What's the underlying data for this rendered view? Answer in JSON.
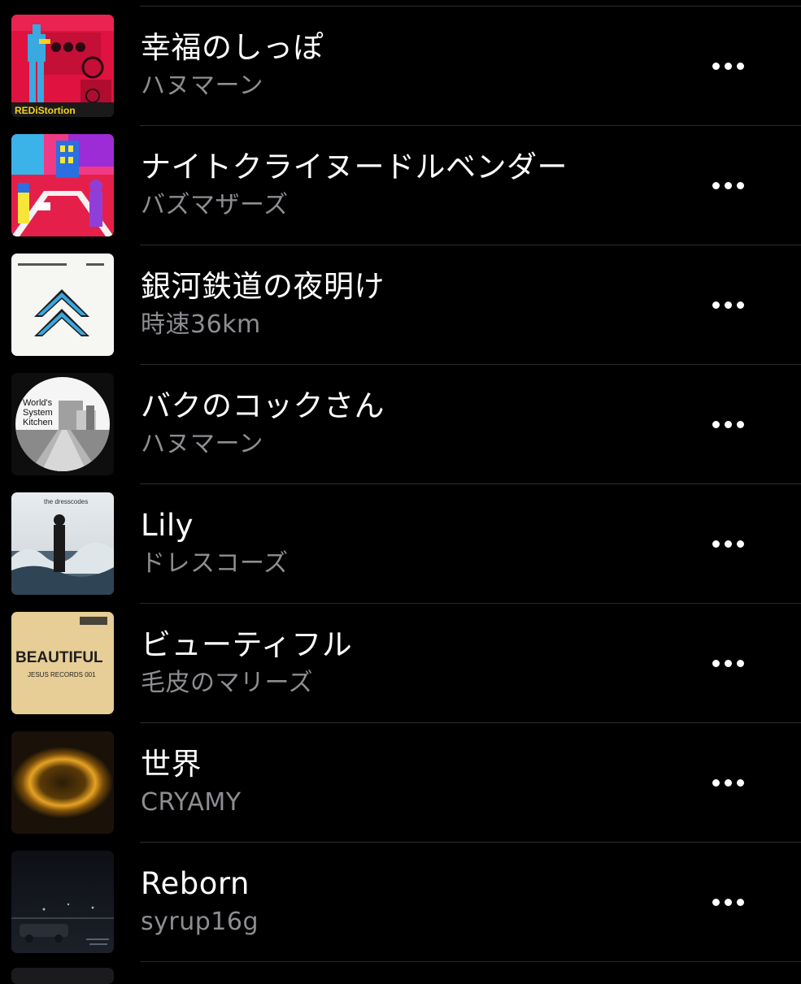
{
  "songs": [
    {
      "title": "幸福のしっぽ",
      "artist": "ハヌマーン",
      "artwork_text": "REDiStortion",
      "artwork_icon": "red-station-artwork"
    },
    {
      "title": "ナイトクライヌードルベンダー",
      "artist": "バズマザーズ",
      "artwork_icon": "colorful-street-artwork"
    },
    {
      "title": "銀河鉄道の夜明け",
      "artist": "時速36km",
      "artwork_icon": "blue-chevron-artwork"
    },
    {
      "title": "バクのコックさん",
      "artist": "ハヌマーン",
      "artwork_text": "World's System Kitchen",
      "artwork_icon": "circle-city-artwork"
    },
    {
      "title": "Lily",
      "artist": "ドレスコーズ",
      "artwork_text": "the dresscodes",
      "artwork_icon": "ocean-figure-artwork"
    },
    {
      "title": "ビューティフル",
      "artist": "毛皮のマリーズ",
      "artwork_text": "BEAUTIFUL",
      "artwork_subtext": "JESUS RECORDS 001",
      "artwork_icon": "beige-text-artwork"
    },
    {
      "title": "世界",
      "artist": "CRYAMY",
      "artwork_icon": "glowing-ring-artwork"
    },
    {
      "title": "Reborn",
      "artist": "syrup16g",
      "artwork_icon": "night-car-artwork"
    }
  ],
  "more_button_icon": "ellipsis-icon"
}
